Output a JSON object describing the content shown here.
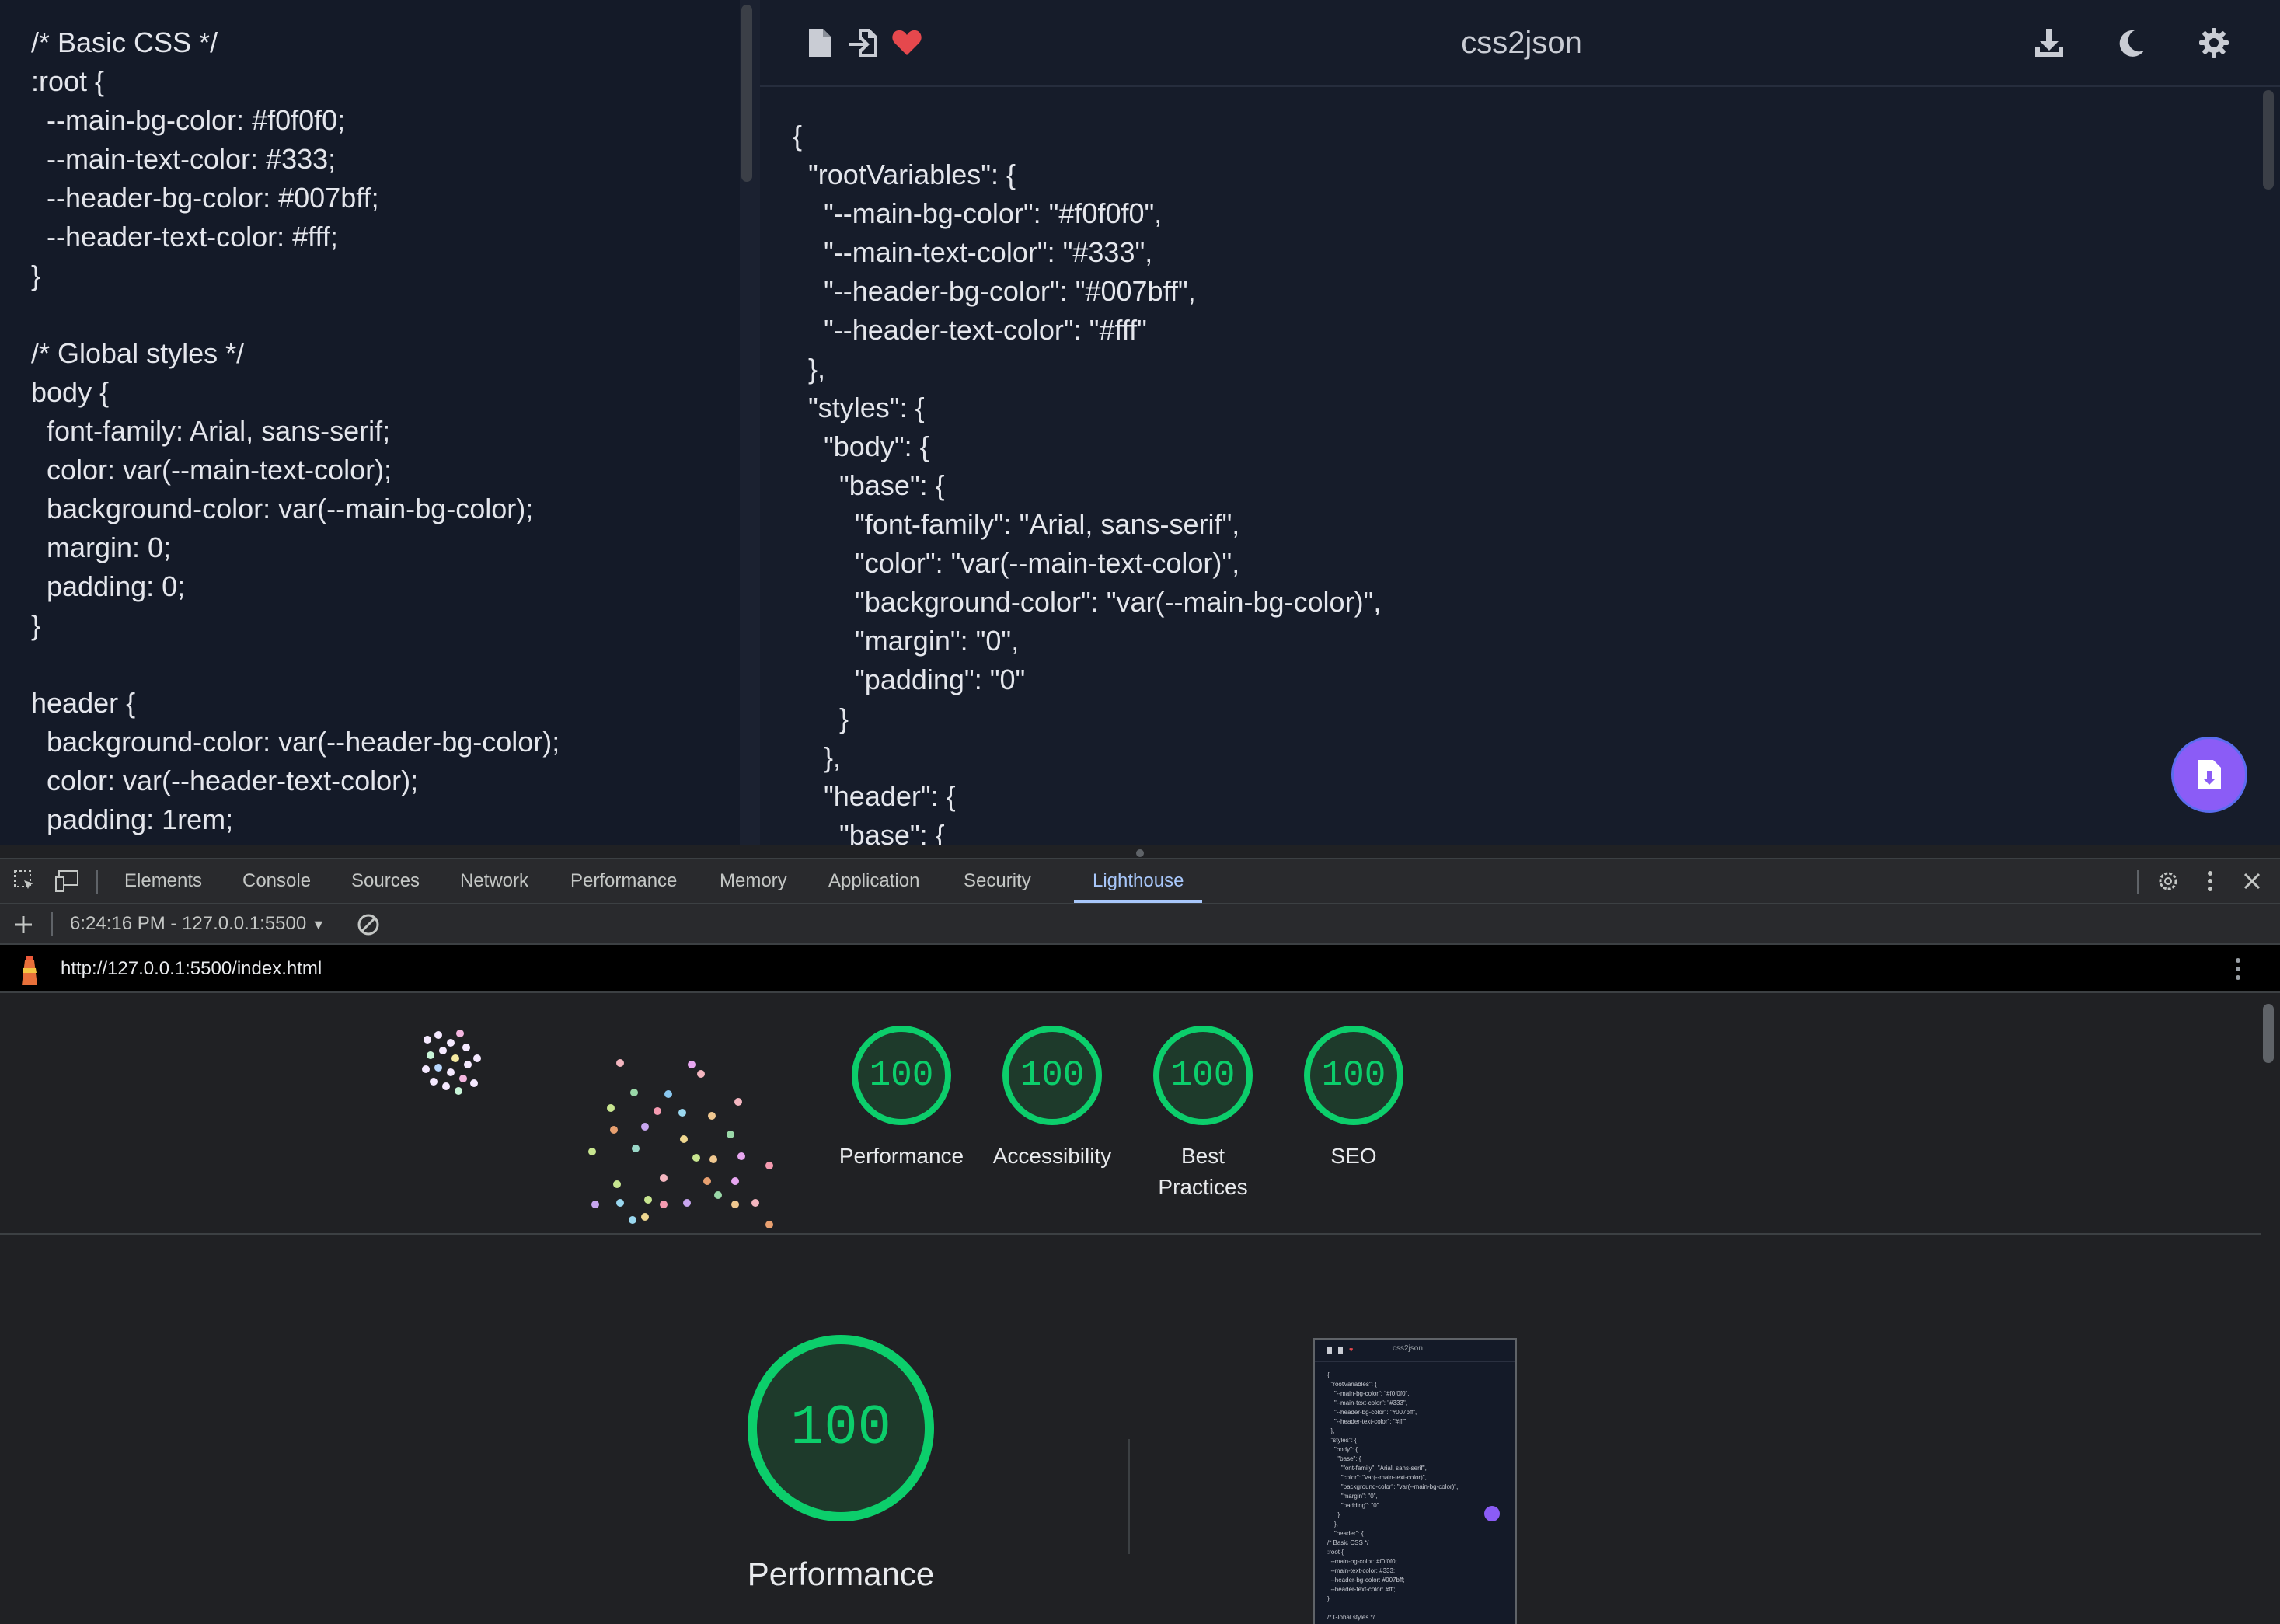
{
  "app": {
    "title": "css2json",
    "colors": {
      "accent": "#8b5cf6",
      "heart": "#e5484d",
      "pass": "#0cce6b"
    },
    "toolbar_left_icons": [
      "new-file-icon",
      "import-icon",
      "heart-icon"
    ],
    "toolbar_right_icons": [
      "download-icon",
      "moon-icon",
      "settings-icon"
    ],
    "css_input": "/* Basic CSS */\n:root {\n  --main-bg-color: #f0f0f0;\n  --main-text-color: #333;\n  --header-bg-color: #007bff;\n  --header-text-color: #fff;\n}\n\n/* Global styles */\nbody {\n  font-family: Arial, sans-serif;\n  color: var(--main-text-color);\n  background-color: var(--main-bg-color);\n  margin: 0;\n  padding: 0;\n}\n\nheader {\n  background-color: var(--header-bg-color);\n  color: var(--header-text-color);\n  padding: 1rem;",
    "json_output": "{\n  \"rootVariables\": {\n    \"--main-bg-color\": \"#f0f0f0\",\n    \"--main-text-color\": \"#333\",\n    \"--header-bg-color\": \"#007bff\",\n    \"--header-text-color\": \"#fff\"\n  },\n  \"styles\": {\n    \"body\": {\n      \"base\": {\n        \"font-family\": \"Arial, sans-serif\",\n        \"color\": \"var(--main-text-color)\",\n        \"background-color\": \"var(--main-bg-color)\",\n        \"margin\": \"0\",\n        \"padding\": \"0\"\n      }\n    },\n    \"header\": {\n      \"base\": {"
  },
  "devtools": {
    "tabs": [
      "Elements",
      "Console",
      "Sources",
      "Network",
      "Performance",
      "Memory",
      "Application",
      "Security",
      "Lighthouse"
    ],
    "active_tab": "Lighthouse",
    "report_selector": "6:24:16 PM - 127.0.0.1:5500",
    "url": "http://127.0.0.1:5500/index.html",
    "scores": [
      {
        "label": "Performance",
        "value": "100"
      },
      {
        "label": "Accessibility",
        "value": "100"
      },
      {
        "label": "Best Practices",
        "value": "100"
      },
      {
        "label": "SEO",
        "value": "100"
      }
    ],
    "main_score": {
      "label": "Performance",
      "value": "100"
    },
    "thumbnail_title": "css2json",
    "thumbnail_text": "{\n  \"rootVariables\": {\n    \"--main-bg-color\": \"#f0f0f0\",\n    \"--main-text-color\": \"#333\",\n    \"--header-bg-color\": \"#007bff\",\n    \"--header-text-color\": \"#fff\"\n  },\n  \"styles\": {\n    \"body\": {\n      \"base\": {\n        \"font-family\": \"Arial, sans-serif\",\n        \"color\": \"var(--main-text-color)\",\n        \"background-color\": \"var(--main-bg-color)\",\n        \"margin\": \"0\",\n        \"padding\": \"0\"\n      }\n    },\n    \"header\": {\n/* Basic CSS */\n:root {\n  --main-bg-color: #f0f0f0;\n  --main-text-color: #333;\n  --header-bg-color: #007bff;\n  --header-text-color: #fff;\n}\n\n/* Global styles */"
  }
}
